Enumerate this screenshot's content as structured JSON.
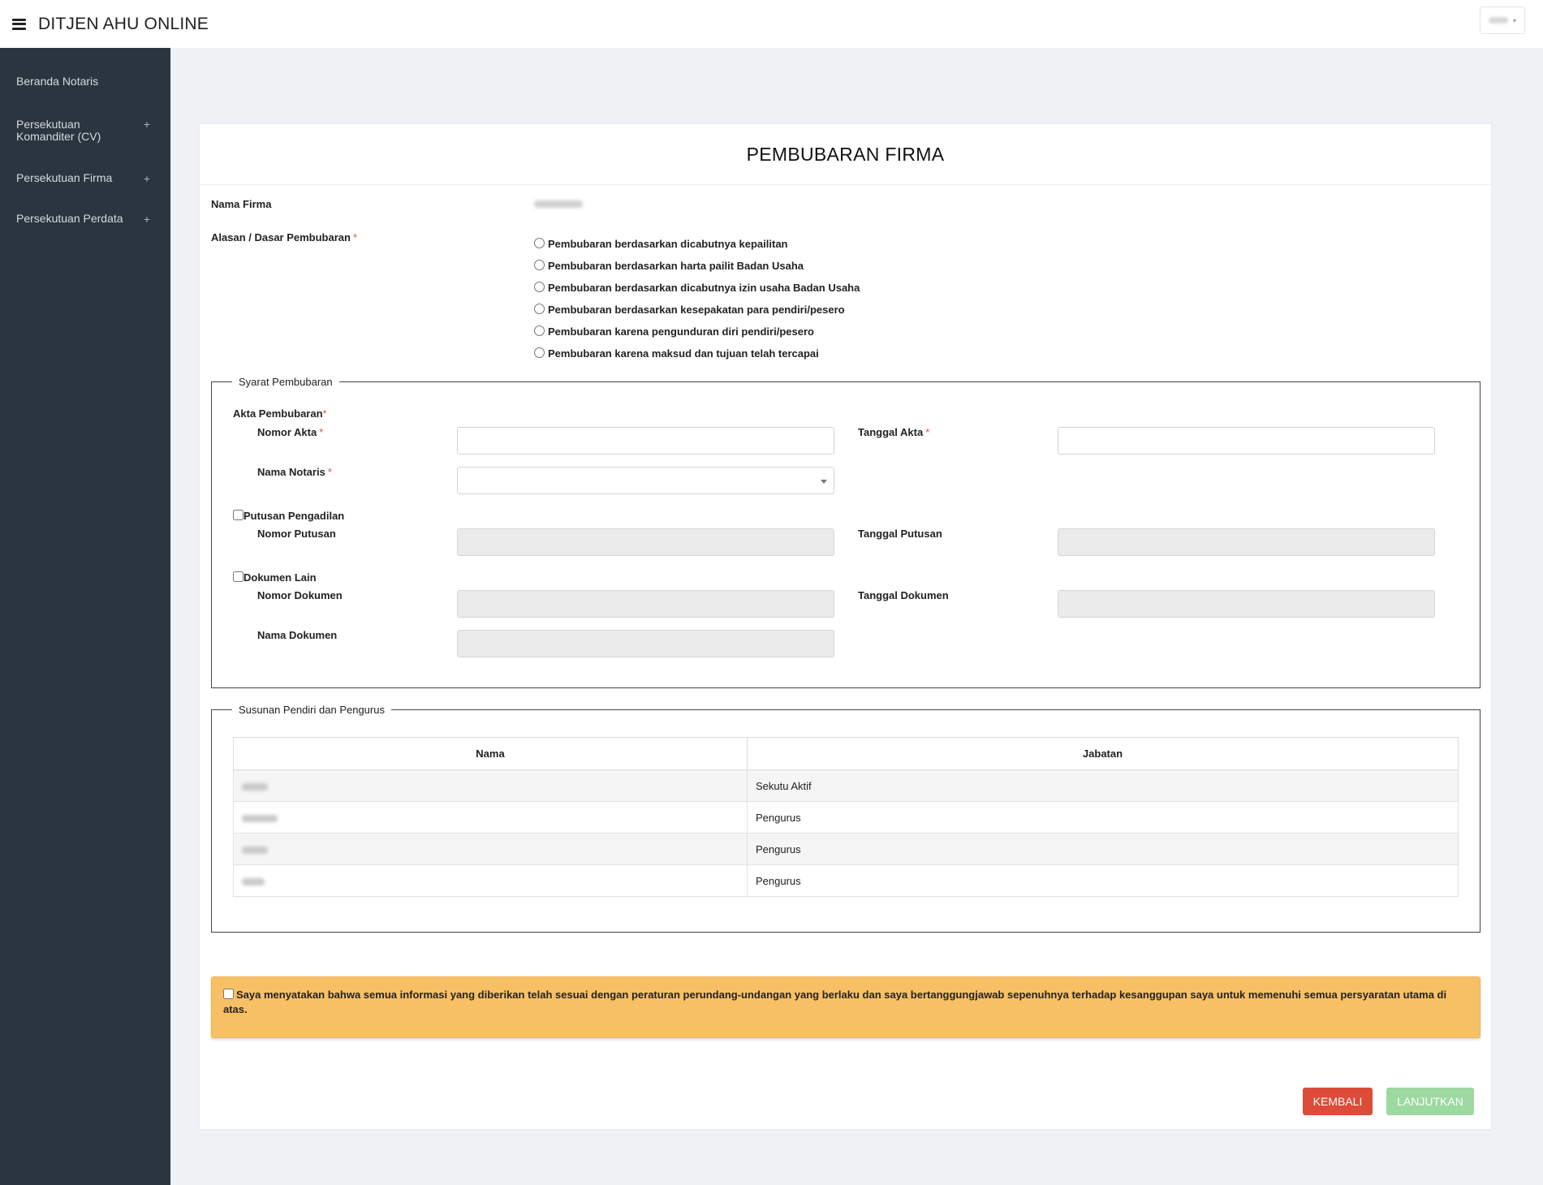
{
  "header": {
    "app_title": "DITJEN AHU ONLINE",
    "menu_icon": "hamburger-icon",
    "user_caret": "▾"
  },
  "sidebar": {
    "items": [
      {
        "label": "Beranda Notaris",
        "expand": ""
      },
      {
        "label": "Persekutuan Komanditer (CV)",
        "expand": "+"
      },
      {
        "label": "Persekutuan Firma",
        "expand": "+"
      },
      {
        "label": "Persekutuan Perdata",
        "expand": "+"
      }
    ]
  },
  "form": {
    "title": "PEMBUBARAN FIRMA",
    "nama_firma_label": "Nama Firma",
    "alasan_label": "Alasan / Dasar Pembubaran",
    "required_mark": "*",
    "alasan_options": [
      "Pembubaran berdasarkan dicabutnya kepailitan",
      "Pembubaran berdasarkan harta pailit Badan Usaha",
      "Pembubaran berdasarkan dicabutnya izin usaha Badan Usaha",
      "Pembubaran berdasarkan kesepakatan para pendiri/pesero",
      "Pembubaran karena pengunduran diri pendiri/pesero",
      "Pembubaran karena maksud dan tujuan telah tercapai"
    ],
    "syarat": {
      "legend": "Syarat Pembubaran",
      "akta_label": "Akta Pembubaran",
      "nomor_akta_label": "Nomor Akta",
      "tanggal_akta_label": "Tanggal Akta",
      "nama_notaris_label": "Nama Notaris",
      "putusan_label": "Putusan Pengadilan",
      "nomor_putusan_label": "Nomor Putusan",
      "tanggal_putusan_label": "Tanggal Putusan",
      "dokumen_label": "Dokumen Lain",
      "nomor_dokumen_label": "Nomor Dokumen",
      "tanggal_dokumen_label": "Tanggal Dokumen",
      "nama_dokumen_label": "Nama Dokumen"
    },
    "susunan": {
      "legend": "Susunan Pendiri dan Pengurus",
      "col_nama": "Nama",
      "col_jabatan": "Jabatan",
      "rows": [
        {
          "jabatan": "Sekutu Aktif"
        },
        {
          "jabatan": "Pengurus"
        },
        {
          "jabatan": "Pengurus"
        },
        {
          "jabatan": "Pengurus"
        }
      ]
    },
    "declaration": "Saya menyatakan bahwa semua informasi yang diberikan telah sesuai dengan peraturan perundang-undangan yang berlaku dan saya bertanggungjawab sepenuhnya terhadap kesanggupan saya untuk memenuhi semua persyaratan utama di atas.",
    "buttons": {
      "back": "KEMBALI",
      "next": "LANJUTKAN"
    }
  },
  "colors": {
    "sidebar_bg": "#2a3540",
    "notice_bg": "#f8c064",
    "back_button": "#dd4b39",
    "next_button": "#9dd9a0",
    "required": "#d9534f"
  }
}
